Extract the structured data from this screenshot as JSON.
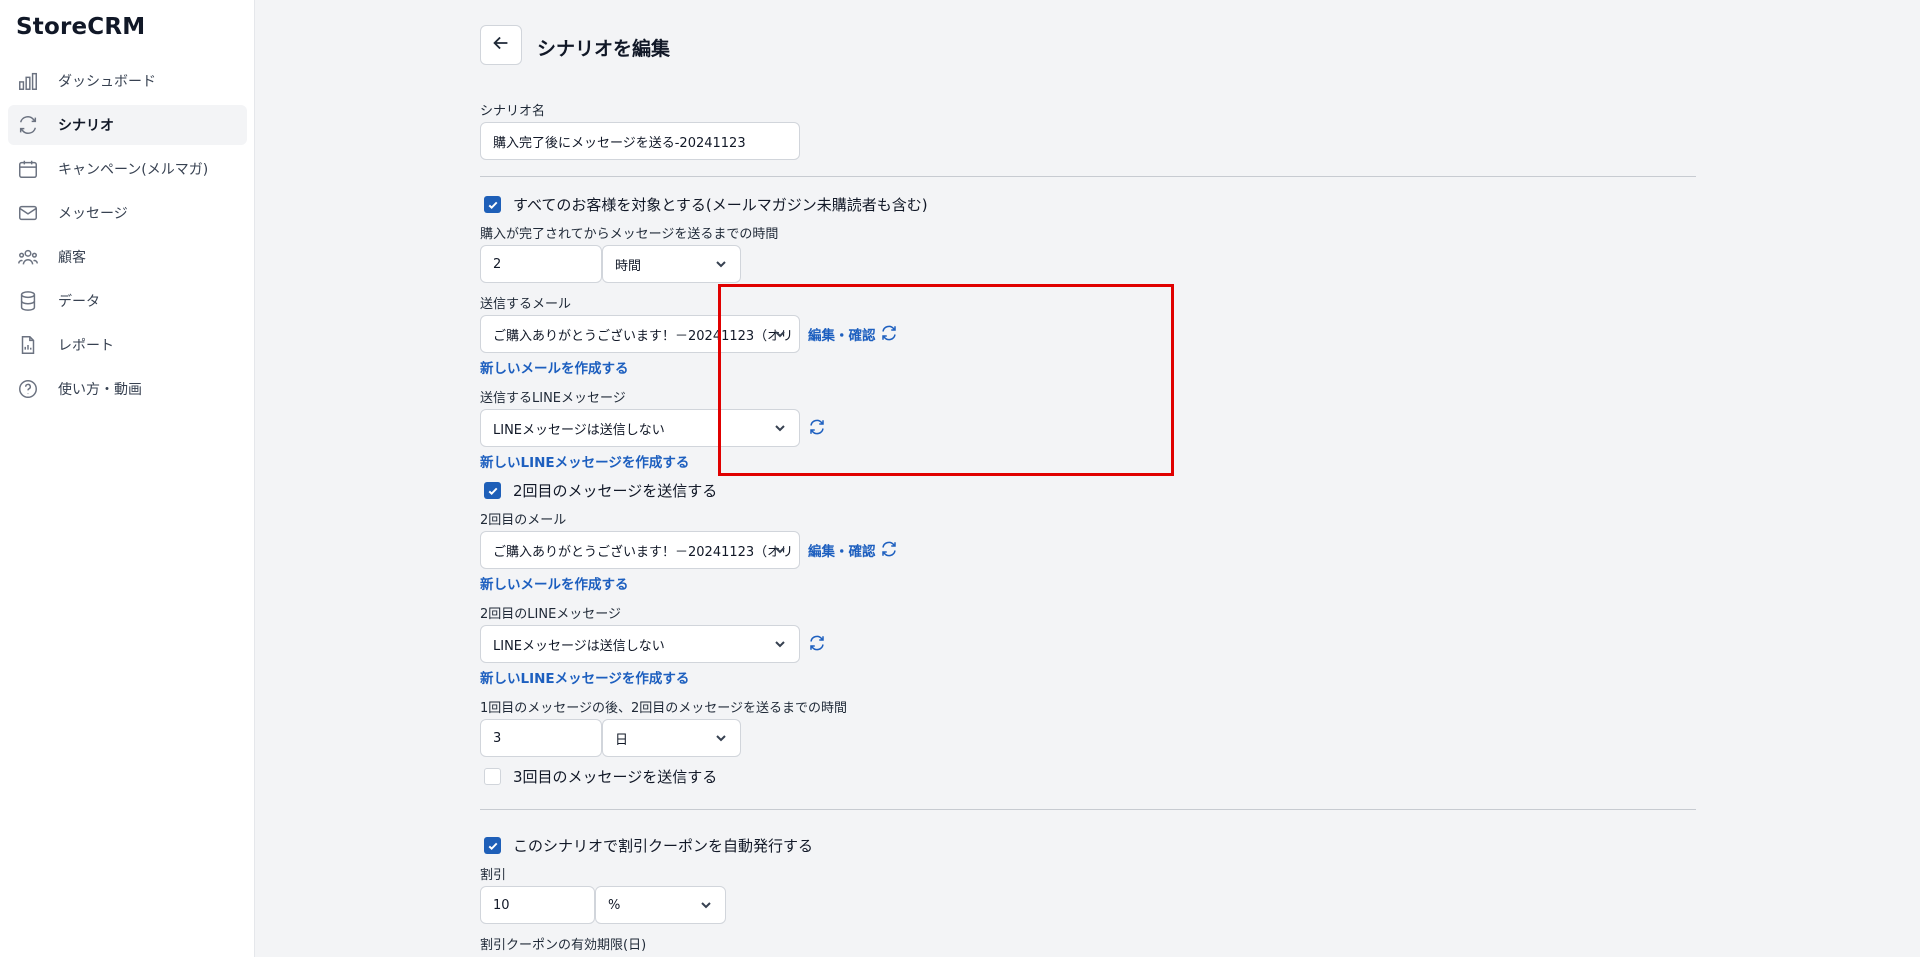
{
  "app": {
    "brand": "StoreCRM"
  },
  "sidebar": {
    "items": [
      {
        "label": "ダッシュボード",
        "icon": "bar-chart-icon",
        "active": false
      },
      {
        "label": "シナリオ",
        "icon": "refresh-cycle-icon",
        "active": true
      },
      {
        "label": "キャンペーン(メルマガ)",
        "icon": "calendar-icon",
        "active": false
      },
      {
        "label": "メッセージ",
        "icon": "mail-icon",
        "active": false
      },
      {
        "label": "顧客",
        "icon": "users-icon",
        "active": false
      },
      {
        "label": "データ",
        "icon": "database-icon",
        "active": false
      },
      {
        "label": "レポート",
        "icon": "report-file-icon",
        "active": false
      },
      {
        "label": "使い方・動画",
        "icon": "help-circle-icon",
        "active": false
      }
    ]
  },
  "header": {
    "title": "シナリオを編集",
    "back_icon": "arrow-left-icon"
  },
  "form": {
    "scenario_name_label": "シナリオ名",
    "scenario_name_value": "購入完了後にメッセージを送る-20241123",
    "all_customers_checkbox": {
      "label": "すべてのお客様を対象とする(メールマガジン未購読者も含む)",
      "checked": true
    },
    "delay_label": "購入が完了されてからメッセージを送るまでの時間",
    "delay_value": "2",
    "delay_unit": "時間",
    "email_label": "送信するメール",
    "email_select": "ご購入ありがとうございます！－20241123（オリ",
    "edit_confirm_link": "編集・確認",
    "new_email_link": "新しいメールを作成する",
    "line_label": "送信するLINEメッセージ",
    "line_select": "LINEメッセージは送信しない",
    "new_line_link": "新しいLINEメッセージを作成する",
    "second_checkbox": {
      "label": "2回目のメッセージを送信する",
      "checked": true
    },
    "second_email_label": "2回目のメール",
    "second_email_select": "ご購入ありがとうございます！－20241123（オリ",
    "second_edit_confirm_link": "編集・確認",
    "second_new_email_link": "新しいメールを作成する",
    "second_line_label": "2回目のLINEメッセージ",
    "second_line_select": "LINEメッセージは送信しない",
    "second_new_line_link": "新しいLINEメッセージを作成する",
    "interval_label": "1回目のメッセージの後、2回目のメッセージを送るまでの時間",
    "interval_value": "3",
    "interval_unit": "日",
    "third_checkbox": {
      "label": "3回目のメッセージを送信する",
      "checked": false
    },
    "coupon_checkbox": {
      "label": "このシナリオで割引クーポンを自動発行する",
      "checked": true
    },
    "discount_label": "割引",
    "discount_value": "10",
    "discount_unit": "%",
    "coupon_expiry_label": "割引クーポンの有効期限(日)"
  },
  "colors": {
    "accent": "#1e5fb8",
    "link": "#1d5fbf",
    "highlight": "#e00000",
    "background": "#f3f4f6"
  }
}
